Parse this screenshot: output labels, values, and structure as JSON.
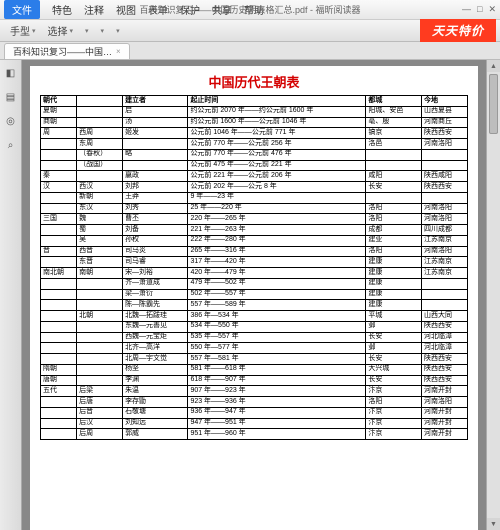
{
  "window": {
    "file_label": "文件",
    "menu": [
      "特色",
      "注释",
      "视图",
      "表单",
      "保护",
      "共享",
      "帮助"
    ],
    "title": "百科知识复习——中国历史朝表格汇总.pdf - 福昕阅读器",
    "win_ctrl": {
      "min": "—",
      "max": "□",
      "close": "✕"
    }
  },
  "toolbar": {
    "items": [
      "手型",
      "选择",
      "",
      "",
      "",
      "",
      ""
    ],
    "promo": "天天特价"
  },
  "tab": {
    "label": "百科知识复习——中国…",
    "close": "×"
  },
  "sidebar_icons": [
    "◧",
    "▤",
    "◎",
    "⌕"
  ],
  "doc_title": "中国历代王朝表",
  "headers": [
    "朝代",
    "",
    "建立者",
    "起止时间",
    "都城",
    "今地"
  ],
  "rows": [
    [
      "夏朝",
      "",
      "启",
      "约公元前 2070 年——约公元前 1600 年",
      "阳城、安邑",
      "山西夏县"
    ],
    [
      "商朝",
      "",
      "汤",
      "约公元前 1600 年——公元前 1046 年",
      "亳、殷",
      "河南商丘"
    ],
    [
      "周",
      "西周",
      "姬发",
      "公元前 1046 年——公元前 771 年",
      "镐京",
      "陕西西安"
    ],
    [
      "",
      "东周",
      "",
      "公元前 770 年——公元前 256 年",
      "洛邑",
      "河南洛阳"
    ],
    [
      "",
      "（春秋）",
      "略",
      "公元前 770 年——公元前 476 年",
      "",
      ""
    ],
    [
      "",
      "（战国）",
      "",
      "公元前 475 年——公元前 221 年",
      "",
      ""
    ],
    [
      "秦",
      "",
      "嬴政",
      "公元前 221 年——公元前 206 年",
      "咸阳",
      "陕西咸阳"
    ],
    [
      "汉",
      "西汉",
      "刘邦",
      "公元前 202 年——公元 8 年",
      "长安",
      "陕西西安"
    ],
    [
      "",
      "新朝",
      "王莽",
      "9 年——23 年",
      "",
      ""
    ],
    [
      "",
      "东汉",
      "刘秀",
      "25 年——220 年",
      "洛阳",
      "河南洛阳"
    ],
    [
      "三国",
      "魏",
      "曹丕",
      "220 年——265 年",
      "洛阳",
      "河南洛阳"
    ],
    [
      "",
      "蜀",
      "刘备",
      "221 年——263 年",
      "成都",
      "四川成都"
    ],
    [
      "",
      "吴",
      "孙权",
      "222 年——280 年",
      "建业",
      "江苏南京"
    ],
    [
      "晋",
      "西晋",
      "司马炎",
      "265 年——316 年",
      "洛阳",
      "河南洛阳"
    ],
    [
      "",
      "东晋",
      "司马睿",
      "317 年——420 年",
      "建康",
      "江苏南京"
    ],
    [
      "南北朝",
      "南朝",
      "宋—刘裕",
      "420 年——479 年",
      "建康",
      "江苏南京"
    ],
    [
      "",
      "",
      "齐—萧道成",
      "479 年——502 年",
      "建康",
      ""
    ],
    [
      "",
      "",
      "梁—萧衍",
      "502 年——557 年",
      "建康",
      ""
    ],
    [
      "",
      "",
      "陈—陈霸先",
      "557 年——589 年",
      "建康",
      ""
    ],
    [
      "",
      "北朝",
      "北魏—拓跋珪",
      "386 年—534 年",
      "平城",
      "山西大同"
    ],
    [
      "",
      "",
      "东魏—元善见",
      "534 年—550 年",
      "邺",
      "陕西西安"
    ],
    [
      "",
      "",
      "西魏—元宝炬",
      "535 年—557 年",
      "长安",
      "河北临漳"
    ],
    [
      "",
      "",
      "北齐—高洋",
      "550 年—577 年",
      "邺",
      "河北临漳"
    ],
    [
      "",
      "",
      "北周—宇文觉",
      "557 年—581 年",
      "长安",
      "陕西西安"
    ],
    [
      "隋朝",
      "",
      "杨坚",
      "581 年——618 年",
      "大兴城",
      "陕西西安"
    ],
    [
      "唐朝",
      "",
      "李渊",
      "618 年——907 年",
      "长安",
      "陕西西安"
    ],
    [
      "五代",
      "后梁",
      "朱温",
      "907 年——923 年",
      "汴京",
      "河南开封"
    ],
    [
      "",
      "后唐",
      "李存勖",
      "923 年——936 年",
      "洛阳",
      "河南洛阳"
    ],
    [
      "",
      "后晋",
      "石敬瑭",
      "936 年——947 年",
      "汴京",
      "河南开封"
    ],
    [
      "",
      "后汉",
      "刘知远",
      "947 年——951 年",
      "汴京",
      "河南开封"
    ],
    [
      "",
      "后周",
      "郭威",
      "951 年——960 年",
      "汴京",
      "河南开封"
    ]
  ]
}
